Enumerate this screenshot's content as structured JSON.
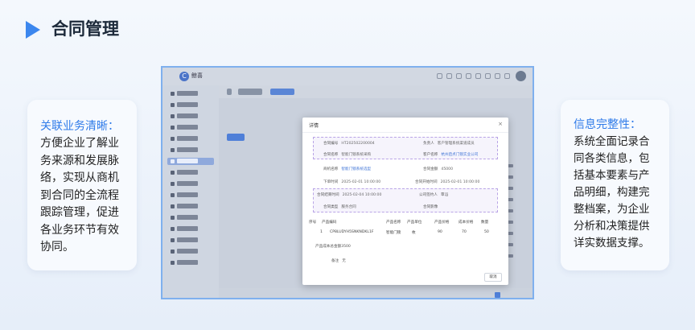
{
  "header": {
    "title": "合同管理"
  },
  "left_card": {
    "title": "关联业务清晰：",
    "body": "方便企业了解业务来源和发展脉络，实现从商机到合同的全流程跟踪管理，促进各业务环节有效协同。"
  },
  "right_card": {
    "title": "信息完整性：",
    "body": "系统全面记录合同各类信息，包括基本要素与产品明细，构建完整档案，为企业分析和决策提供详实数据支撑。"
  },
  "screenshot": {
    "logo_text": "鲸喜",
    "modal": {
      "title": "详情",
      "close": "×",
      "section1": [
        {
          "k": "合同编号",
          "v": "HT202502200004"
        },
        {
          "k": "负责人",
          "v": "客户管理系统渠道成员"
        },
        {
          "k": "合同名称",
          "v": "智能门锁系统采购"
        },
        {
          "k": "客户名称",
          "v": "杭州启点门锁实业公司",
          "link": true
        }
      ],
      "section_mid": [
        {
          "k": "商机名称",
          "v": "智能门锁系统选型",
          "link": true
        },
        {
          "k": "合同金额",
          "v": "45000"
        },
        {
          "k": "下单时间",
          "v": "2025-02-01 10:00:00"
        },
        {
          "k": "合同开始时间",
          "v": "2025-02-01 10:00:00"
        }
      ],
      "section2": [
        {
          "k": "合同结束时间",
          "v": "2025-02-04 10:00:00"
        },
        {
          "k": "公司签约人",
          "v": "覃滔"
        },
        {
          "k": "合同类型",
          "v": "服务合同"
        },
        {
          "k": "合同影像",
          "v": ""
        }
      ],
      "table": {
        "headers": [
          "序号",
          "产品编码",
          "产品名称",
          "产品单位",
          "产品价格",
          "成本价格",
          "数量"
        ],
        "rows": [
          [
            "1",
            "CP8LUDYH5SNKNDKL1F",
            "智能门锁",
            "枚",
            "90",
            "70",
            "50"
          ]
        ]
      },
      "total_cost": "产品成本总金额3500",
      "remark_label": "备注",
      "remark_value": "无",
      "close_button": "取消"
    }
  }
}
